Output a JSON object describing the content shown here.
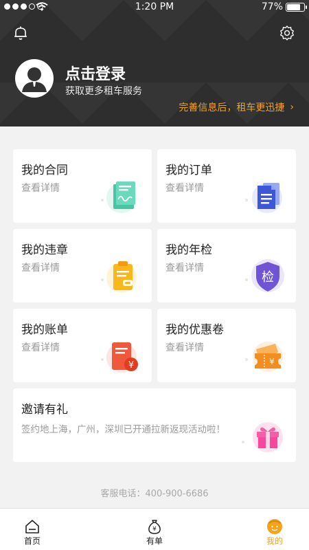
{
  "status_bar": {
    "time": "1:20 PM",
    "battery": "77%",
    "battery_level": 0.77
  },
  "header": {
    "login_title": "点击登录",
    "login_subtitle": "获取更多租车服务",
    "promo_text": "完善信息后，租车更迅捷",
    "promo_chevron": "›"
  },
  "cards": [
    {
      "title": "我的合同",
      "subtitle": "查看详情",
      "icon": "contract-icon"
    },
    {
      "title": "我的订单",
      "subtitle": "查看详情",
      "icon": "order-document-icon"
    },
    {
      "title": "我的违章",
      "subtitle": "查看详情",
      "icon": "violation-clipboard-icon"
    },
    {
      "title": "我的年检",
      "subtitle": "查看详情",
      "icon": "inspection-shield-icon"
    },
    {
      "title": "我的账单",
      "subtitle": "查看详情",
      "icon": "bill-yuan-icon"
    },
    {
      "title": "我的优惠卷",
      "subtitle": "查看详情",
      "icon": "coupon-ticket-icon"
    },
    {
      "title": "邀请有礼",
      "subtitle": "签约地上海，广州，深圳已开通拉新返现活动啦！",
      "icon": "gift-box-icon"
    }
  ],
  "badges": {
    "inspection_char": "检",
    "yuan_char": "¥"
  },
  "service_phone": "客服电话：400-900-6686",
  "tabbar": [
    {
      "label": "首页",
      "icon": "home-icon",
      "active": false
    },
    {
      "label": "有单",
      "icon": "money-bag-icon",
      "active": false
    },
    {
      "label": "我的",
      "icon": "profile-face-icon",
      "active": true
    }
  ],
  "colors": {
    "accent": "#f5a319",
    "header_bg": "#2e2e2e",
    "page_bg": "#f2f2f2"
  }
}
